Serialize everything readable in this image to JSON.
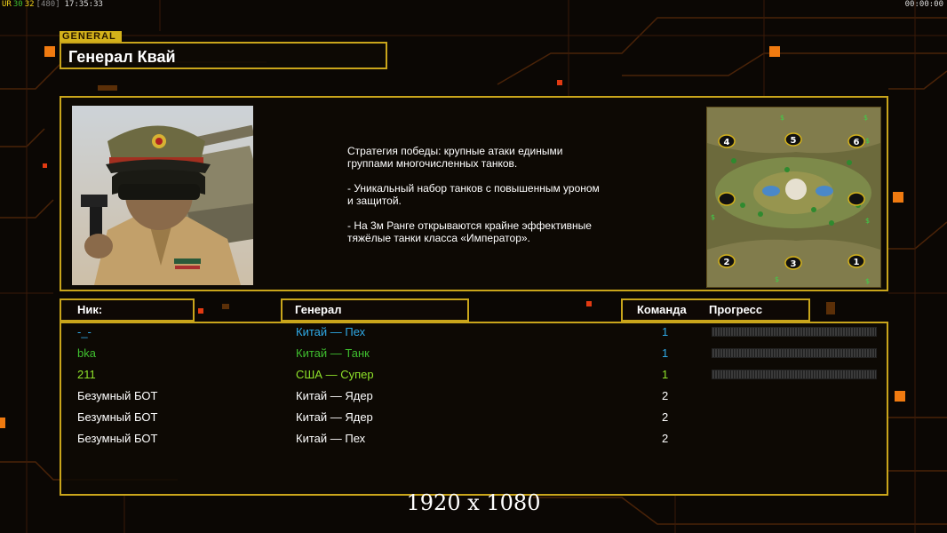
{
  "status_bar": {
    "a": "UR",
    "b": "30",
    "c": "32",
    "d": "[480]",
    "time": "17:35:33",
    "timer": "00:00:00"
  },
  "general_tag": "GENERAL",
  "general_name": "Генерал Квай",
  "description": "Стратегия победы: крупные атаки едиными\n группами многочисленных танков.\n\n- Уникальный набор танков с повышенным уроном\n и защитой.\n\n- На 3м Ранге открываются крайне эффективные\n тяжёлые танки класса «Император».",
  "map": {
    "slots": [
      "4",
      "5",
      "6",
      "2",
      "3",
      "1"
    ]
  },
  "headers": {
    "nick": "Ник:",
    "general": "Генерал",
    "team": "Команда",
    "progress": "Прогресс"
  },
  "players": [
    {
      "nick": "-_-",
      "general": "Китай — Пех",
      "team": "1",
      "color": "#2fa9e6"
    },
    {
      "nick": "bka",
      "general": "Китай — Танк",
      "team": "1",
      "color": "#3fbf2f"
    },
    {
      "nick": "211",
      "general": "США — Супер",
      "team": "1",
      "color": "#8fe22a"
    },
    {
      "nick": "Безумный БОТ",
      "general": "Китай — Ядер",
      "team": "2",
      "color": "#ffffff"
    },
    {
      "nick": "Безумный БОТ",
      "general": "Китай — Ядер",
      "team": "2",
      "color": "#ffffff"
    },
    {
      "nick": "Безумный БОТ",
      "general": "Китай — Пех",
      "team": "2",
      "color": "#ffffff"
    }
  ],
  "resolution": "1920 x 1080",
  "colors": {
    "accent": "#c9a51b",
    "orange": "#f07a10"
  }
}
